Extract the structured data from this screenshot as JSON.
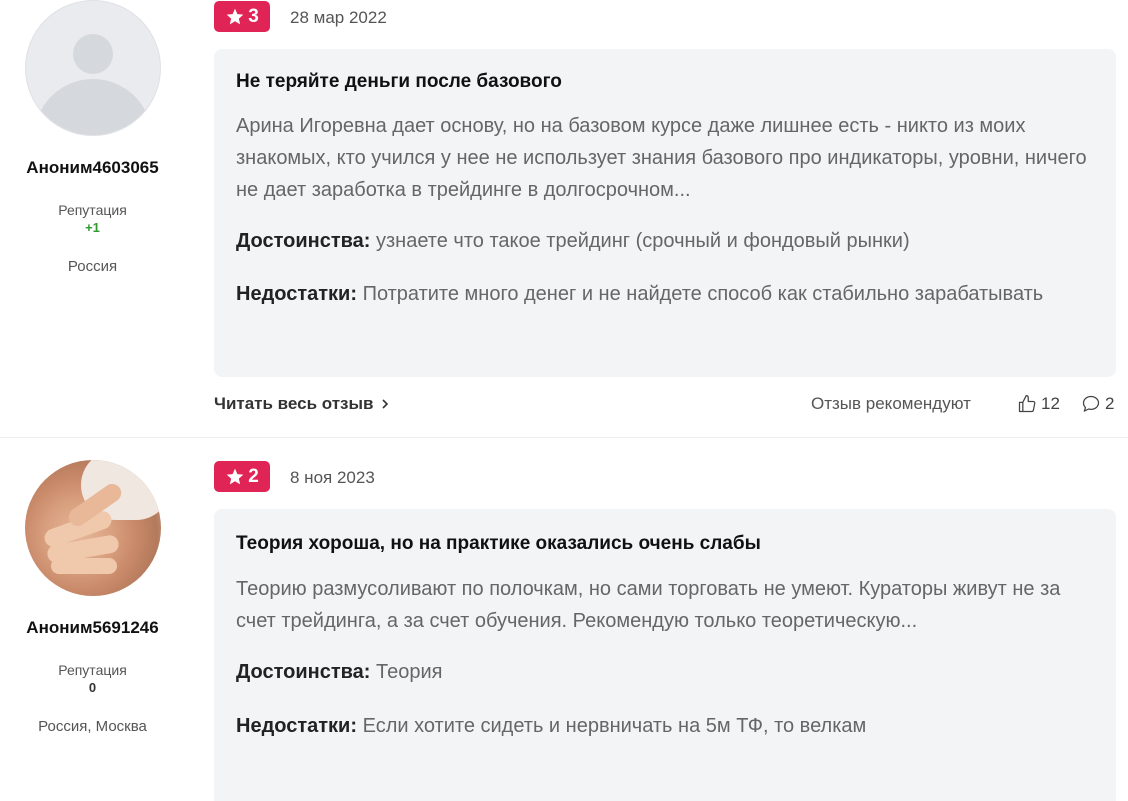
{
  "reviews": [
    {
      "author": {
        "name": "Аноним4603065",
        "reputation_label": "Репутация",
        "reputation_value": "+1",
        "location": "Россия",
        "avatar": "default-avatar-icon"
      },
      "rating": "3",
      "date": "28 мар 2022",
      "title": "Не теряйте деньги после базового",
      "body": "Арина Игоревна дает основу, но на базовом курсе даже лишнее есть - никто из моих знакомых, кто учился у нее не использует знания базового про индикаторы, уровни, ничего не дает заработка в трейдинге в долгосрочном...",
      "pros_label": "Достоинства:",
      "pros": "узнаете что такое трейдинг (срочный и фондовый рынки)",
      "cons_label": "Недостатки:",
      "cons": "Потратите много денег и не найдете способ как стабильно зарабатывать",
      "read_more": "Читать весь отзыв",
      "recommend": "Отзыв рекомендуют",
      "likes": "12",
      "comments": "2"
    },
    {
      "author": {
        "name": "Аноним5691246",
        "reputation_label": "Репутация",
        "reputation_value": "0",
        "location": "Россия, Москва",
        "avatar": "hands-photo-avatar"
      },
      "rating": "2",
      "date": "8 ноя 2023",
      "title": "Теория хороша, но на практике оказались очень слабы",
      "body": "Теорию размусоливают по полочкам, но сами торговать не умеют. Кураторы живут не за счет трейдинга, а за счет обучения. Рекомендую только теоретическую...",
      "pros_label": "Достоинства:",
      "pros": "Теория",
      "cons_label": "Недостатки:",
      "cons": "Если хотите сидеть и нервничать на 5м ТФ, то велкам"
    }
  ],
  "colors": {
    "rating_badge": "#e02455",
    "bubble_bg": "#f3f4f6",
    "reputation_positive": "#2e9b2e"
  },
  "icons": {
    "star": "star-icon",
    "chevron": "chevron-right-icon",
    "like": "thumbs-up-icon",
    "comment": "comment-icon"
  }
}
